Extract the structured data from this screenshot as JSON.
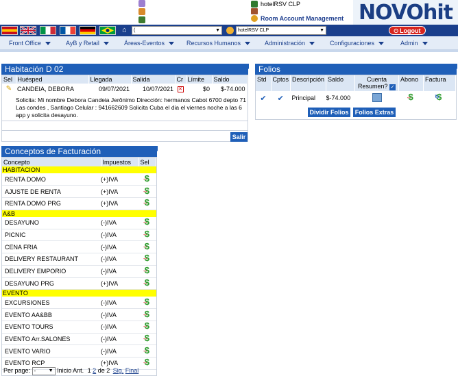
{
  "header": {
    "hotel_name": "hotelRSV CLP",
    "room_account_management": "Room Account Management",
    "logo_text": "NOVOhit"
  },
  "toolbar": {
    "flags": [
      {
        "name": "es-flag",
        "colors": [
          "#c60b1e",
          "#ffc400"
        ]
      },
      {
        "name": "uk-flag",
        "colors": [
          "#012169",
          "#c8102e"
        ]
      },
      {
        "name": "it-flag",
        "colors": [
          "#009246",
          "#ffffff",
          "#ce2b37"
        ]
      },
      {
        "name": "fr-flag",
        "colors": [
          "#0055a4",
          "#ffffff",
          "#ef4135"
        ]
      },
      {
        "name": "de-flag",
        "colors": [
          "#000000",
          "#dd0000",
          "#ffce00"
        ]
      },
      {
        "name": "br-flag",
        "colors": [
          "#009c3b",
          "#ffdf00"
        ]
      }
    ],
    "company_select_value": "(",
    "hotel_select_value": "hotelRSV CLP",
    "logout_label": "Logout"
  },
  "menu": [
    {
      "label": "Front Office"
    },
    {
      "label": "AyB y Retail"
    },
    {
      "label": "Áreas-Eventos"
    },
    {
      "label": "Recursos Humanos"
    },
    {
      "label": "Administración"
    },
    {
      "label": "Configuraciones"
    },
    {
      "label": "Admin"
    }
  ],
  "habitacion": {
    "title": "Habitación D 02",
    "columns": [
      "Sel",
      "Huésped",
      "Llegada",
      "Salida",
      "Cr",
      "Límite",
      "Saldo"
    ],
    "row": {
      "huesped": "CANDEIA, DEBORA",
      "llegada": "09/07/2021",
      "salida": "10/07/2021",
      "limite": "$0",
      "saldo": "$-74.000"
    },
    "note": "Solicita: Mi nombre Debora Candeia Jerônimo Dirección: hermanos Cabot 6700 depto 71 Las condes , Santiago Celular : 941662609 Solicita Cuba el dia el viernes noche a las 6 app y solicita desayuno.",
    "salir_label": "Salir"
  },
  "folios": {
    "title": "Folios",
    "columns": [
      "Std",
      "Cptos",
      "Descripción",
      "Saldo",
      "Cuenta Resumen?",
      "Abono",
      "Factura"
    ],
    "row": {
      "descripcion": "Principal",
      "saldo": "$-74.000"
    },
    "dividir_label": "Dividir Folios",
    "extras_label": "Folios Extras"
  },
  "conceptos": {
    "title": "Conceptos de Facturación",
    "columns": [
      "Concepto",
      "Impuestos",
      "Sel"
    ],
    "groups": [
      {
        "name": "HABITACION",
        "items": [
          {
            "concepto": "RENTA DOMO",
            "impuestos": "(+)IVA"
          },
          {
            "concepto": "AJUSTE DE RENTA",
            "impuestos": "(+)IVA"
          },
          {
            "concepto": "RENTA DOMO PRG",
            "impuestos": "(+)IVA"
          }
        ]
      },
      {
        "name": "A&B",
        "items": [
          {
            "concepto": "DESAYUNO",
            "impuestos": "(-)IVA"
          },
          {
            "concepto": "PICNIC",
            "impuestos": "(-)IVA"
          },
          {
            "concepto": "CENA FRIA",
            "impuestos": "(-)IVA"
          },
          {
            "concepto": "DELIVERY RESTAURANT",
            "impuestos": "(-)IVA"
          },
          {
            "concepto": "DELIVERY EMPORIO",
            "impuestos": "(-)IVA"
          },
          {
            "concepto": "DESAYUNO PRG",
            "impuestos": "(+)IVA"
          }
        ]
      },
      {
        "name": "EVENTO",
        "items": [
          {
            "concepto": "EXCURSIONES",
            "impuestos": "(-)IVA"
          },
          {
            "concepto": "EVENTO AA&BB",
            "impuestos": "(-)IVA"
          },
          {
            "concepto": "EVENTO TOURS",
            "impuestos": "(-)IVA"
          },
          {
            "concepto": "EVENTO Arr.SALONES",
            "impuestos": "(-)IVA"
          },
          {
            "concepto": "EVENTO VARIO",
            "impuestos": "(-)IVA"
          },
          {
            "concepto": "EVENTO RCP",
            "impuestos": "(+)IVA"
          }
        ]
      }
    ],
    "pager": {
      "per_page_label": "Per page:",
      "per_page_value": "-",
      "inicio": "Inicio",
      "ant": "Ant.",
      "page1": "1",
      "page2": "2",
      "of_label": "de 2",
      "sig": "Sig.",
      "final": "Final"
    }
  },
  "colors": {
    "accent": "#1f5fb8",
    "navy": "#1a3f8c",
    "group_highlight": "#ffff00",
    "logout": "#d7241e"
  }
}
